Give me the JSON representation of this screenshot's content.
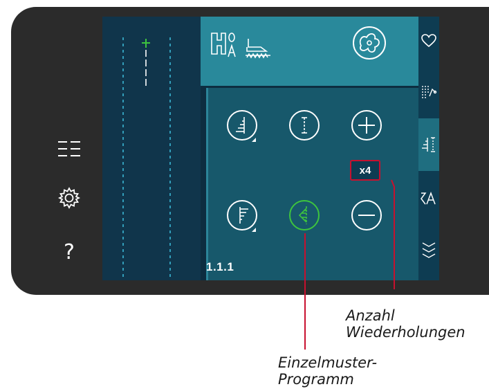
{
  "screen": {
    "program_number": "1.1.1",
    "repeat_badge": "x4"
  },
  "left_sidebar": {
    "icons": [
      "menu-icon",
      "settings-gear-icon",
      "help-icon"
    ],
    "help_glyph": "?"
  },
  "top_panel": {
    "icons": [
      "stitch-program-hA-icon",
      "presser-foot-icon",
      "thread-spool-button-icon"
    ]
  },
  "controls": {
    "row1": [
      "tie-off-start-icon",
      "single-stitch-program-top-icon",
      "plus-icon"
    ],
    "row2": [
      "tie-off-end-icon",
      "single-stitch-program-icon",
      "minus-icon"
    ]
  },
  "right_tabs": {
    "items": [
      "heart-favorites-tab",
      "stitch-sequence-tab",
      "stitch-program-tab",
      "font-tab",
      "decorative-stitch-tab"
    ],
    "active_index": 2
  },
  "callouts": {
    "repeat_count": "Anzahl Wiederholungen",
    "repeat_line1": "Anzahl",
    "repeat_line2": "Wiederholungen",
    "single_program": "Einzelmuster-Programm",
    "single_line1": "Einzelmuster-",
    "single_line2": "Programm"
  },
  "colors": {
    "accent_green": "#3ec43e",
    "callout_red": "#c8102e",
    "top_panel": "#29899b",
    "sub_panel": "#17586b",
    "screen_bg": "#0d2d40"
  }
}
